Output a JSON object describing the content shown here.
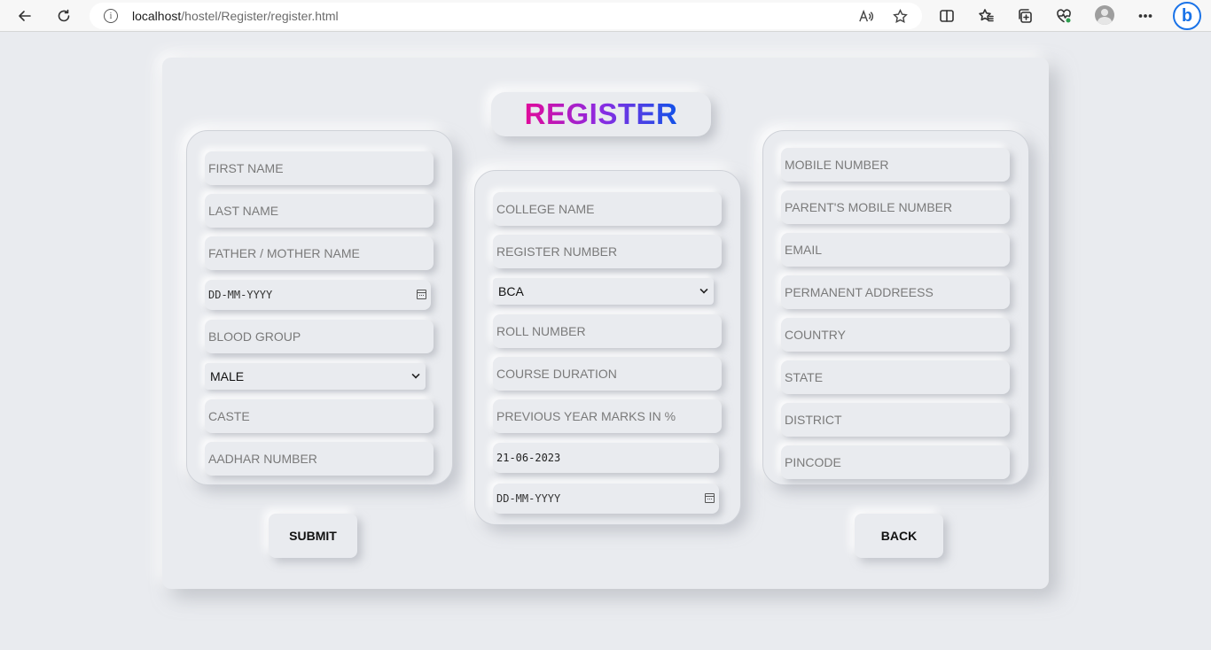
{
  "browser": {
    "url_host": "localhost",
    "url_path": "/hostel/Register/register.html"
  },
  "page": {
    "title": "REGISTER",
    "left_panel": {
      "first_name": "FIRST NAME",
      "last_name": "LAST NAME",
      "parent_name": "FATHER / MOTHER NAME",
      "dob": "DD-MM-YYYY",
      "blood_group": "BLOOD GROUP",
      "gender": "MALE",
      "caste": "CASTE",
      "aadhar": "AADHAR NUMBER"
    },
    "middle_panel": {
      "college_name": "COLLEGE NAME",
      "register_number": "REGISTER NUMBER",
      "course": "BCA",
      "roll_number": "ROLL NUMBER",
      "course_duration": "COURSE DURATION",
      "previous_marks": "PREVIOUS YEAR MARKS IN %",
      "join_date": "21-06-2023",
      "end_date": "DD-MM-YYYY"
    },
    "right_panel": {
      "mobile": "MOBILE NUMBER",
      "parent_mobile": "PARENT'S MOBILE NUMBER",
      "email": "EMAIL",
      "address": "PERMANENT ADDREESS",
      "country": "COUNTRY",
      "state": "STATE",
      "district": "DISTRICT",
      "pincode": "PINCODE"
    },
    "submit_label": "SUBMIT",
    "back_label": "BACK"
  },
  "icons": {
    "title_gradient": [
      "#e10a9a",
      "#8a2be2",
      "#1252e8"
    ],
    "bing_color": "#1a73e8"
  }
}
